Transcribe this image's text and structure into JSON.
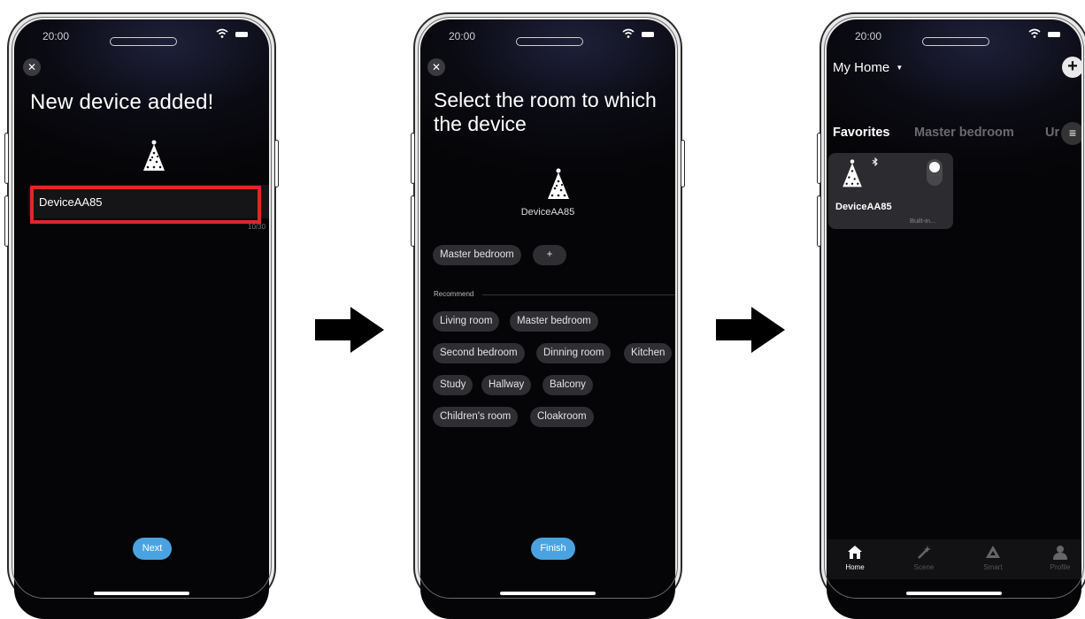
{
  "status_bar": {
    "time": "20:00"
  },
  "screen1": {
    "title": "New device added!",
    "device_name_value": "DeviceAA85",
    "name_counter": "10/30",
    "next_label": "Next"
  },
  "screen2": {
    "title": "Select the room to which the device",
    "device_name": "DeviceAA85",
    "selected_rooms": [
      "Master bedroom"
    ],
    "add_room_label": "+",
    "recommend_label": "Recommend",
    "recommend_rooms": [
      "Living room",
      "Master bedroom",
      "Second bedroom",
      "Dinning room",
      "Kitchen",
      "Study",
      "Hallway",
      "Balcony",
      "Children's room",
      "Cloakroom"
    ],
    "finish_label": "Finish"
  },
  "screen3": {
    "home_name": "My Home",
    "home_dropdown_icon": "caret-down-icon",
    "tabs": [
      "Favorites",
      "Master bedroom",
      "Ur"
    ],
    "device_card": {
      "name": "DeviceAA85",
      "status": "Built-in..."
    },
    "tabbar": [
      "Home",
      "Scene",
      "Smart",
      "Profile"
    ]
  },
  "colors": {
    "highlight_box": "#e0262c",
    "primary_button": "#4aa3e0",
    "screen_bg": "#050507"
  },
  "icons": [
    "close-icon",
    "christmas-tree-icon",
    "arrow-right-icon",
    "plus-icon",
    "menu-icon",
    "bluetooth-icon",
    "home-icon",
    "scene-icon",
    "smart-icon",
    "profile-icon"
  ]
}
